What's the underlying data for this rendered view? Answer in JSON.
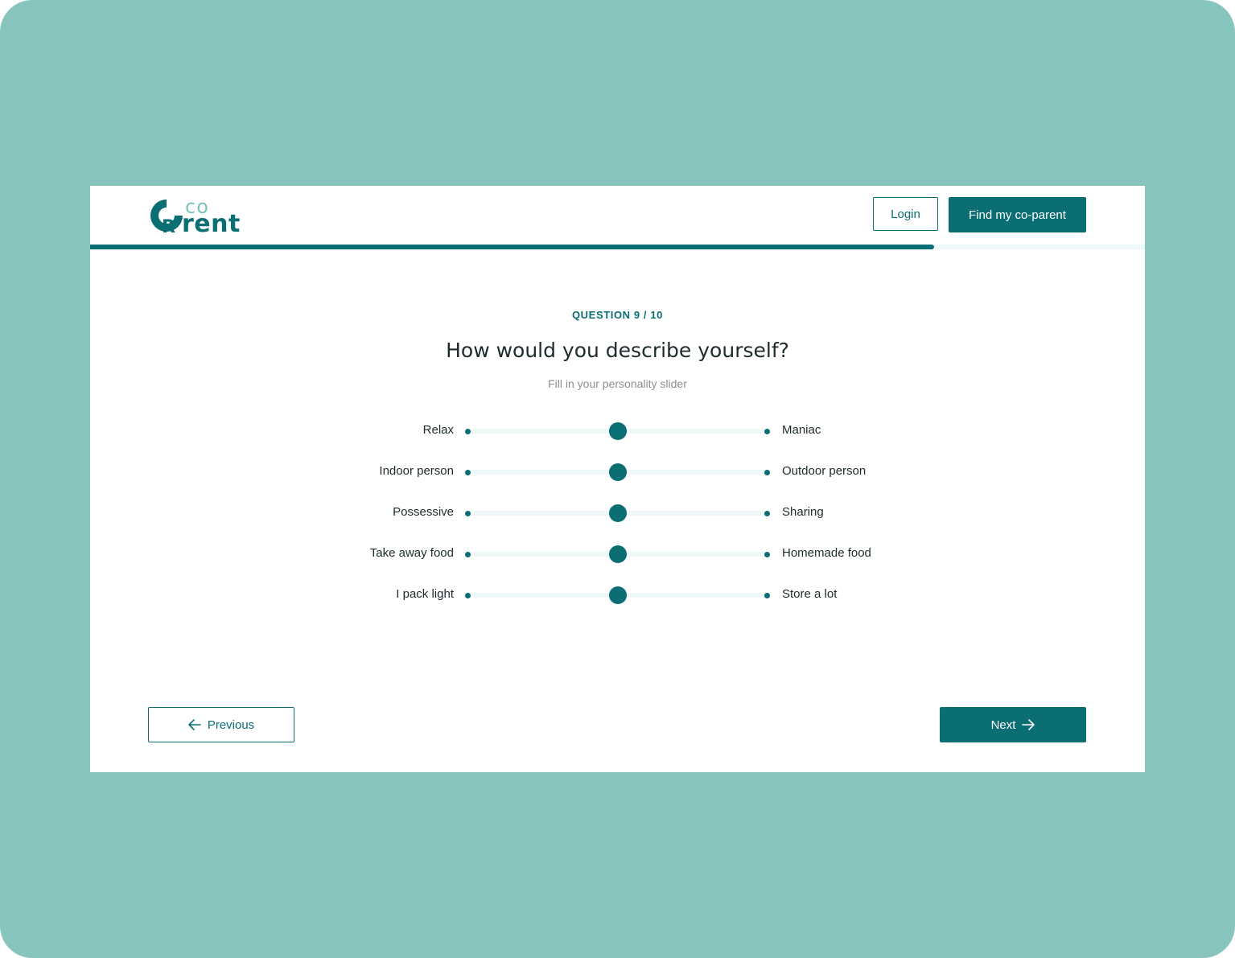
{
  "brand": {
    "logo_co": "co",
    "logo_rent": "rent"
  },
  "header": {
    "login_label": "Login",
    "find_label": "Find my co-parent"
  },
  "progress": {
    "current": 9,
    "total": 10,
    "fraction": 0.8
  },
  "question": {
    "counter": "QUESTION 9 / 10",
    "title": "How would you describe yourself?",
    "subtitle": "Fill in your personality slider"
  },
  "sliders": [
    {
      "left": "Relax",
      "right": "Maniac",
      "value": 0.5
    },
    {
      "left": "Indoor person",
      "right": "Outdoor person",
      "value": 0.5
    },
    {
      "left": "Possessive",
      "right": "Sharing",
      "value": 0.5
    },
    {
      "left": "Take away food",
      "right": "Homemade food",
      "value": 0.5
    },
    {
      "left": "I pack light",
      "right": "Store a lot",
      "value": 0.5
    }
  ],
  "nav": {
    "previous_label": "Previous",
    "next_label": "Next"
  },
  "colors": {
    "primary": "#0a6e73",
    "background": "#88c4be",
    "accent_light": "#7fc3bc"
  },
  "icons": {
    "previous": "arrow-left-icon",
    "next": "arrow-right-icon"
  }
}
